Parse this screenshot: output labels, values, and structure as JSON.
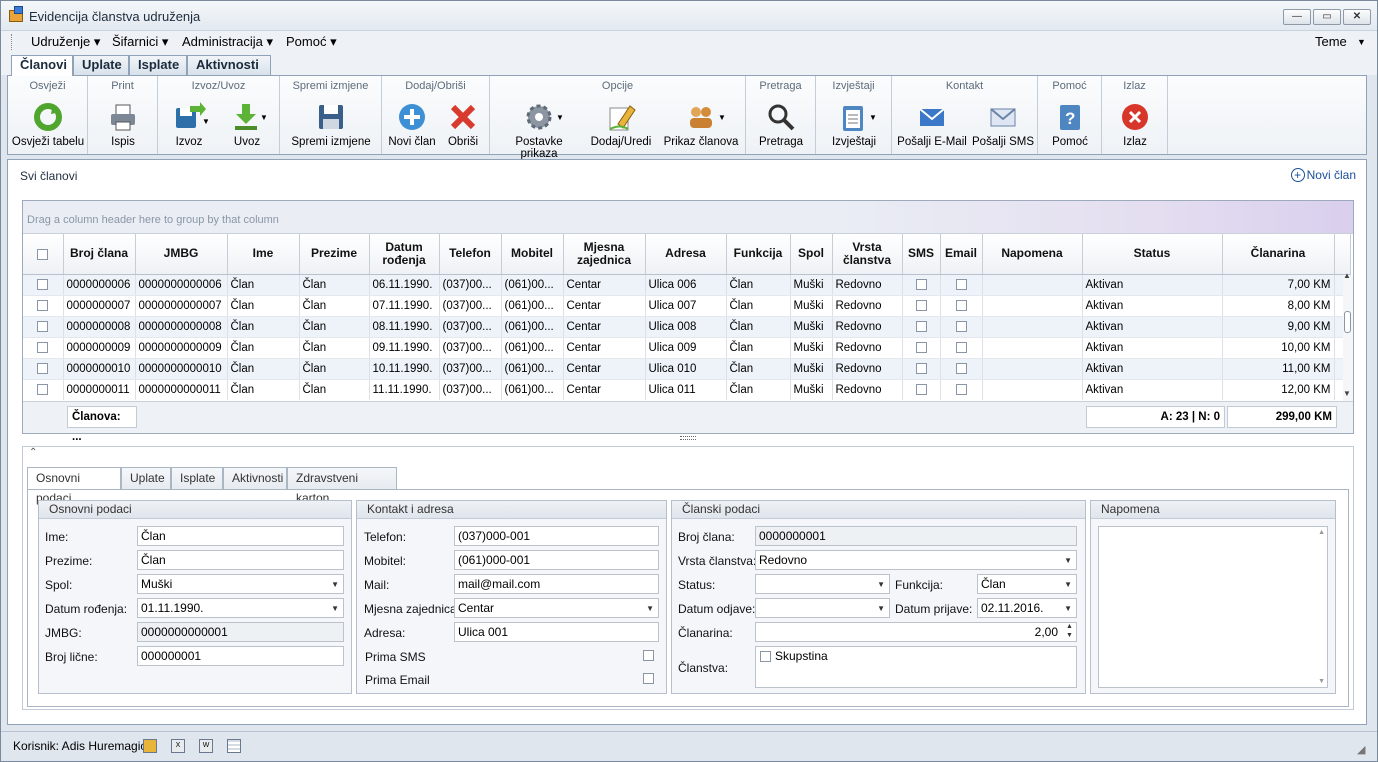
{
  "window": {
    "title": "Evidencija članstva udruženja"
  },
  "menu": [
    "Udruženje",
    "Šifarnici",
    "Administracija",
    "Pomoć"
  ],
  "theme_label": "Teme",
  "main_tabs": [
    "Članovi",
    "Uplate",
    "Isplate",
    "Aktivnosti"
  ],
  "ribbon": {
    "groups": [
      "Osvježi",
      "Print",
      "Izvoz/Uvoz",
      "Spremi izmjene",
      "Dodaj/Obriši",
      "Opcije",
      "Pretraga",
      "Izvještaji",
      "Kontakt",
      "Pomoć",
      "Izlaz"
    ],
    "buttons": [
      "Osvježi tabelu",
      "Ispis",
      "Izvoz",
      "Uvoz",
      "Spremi izmjene",
      "Novi član",
      "Obriši",
      "Postavke prikaza",
      "Dodaj/Uredi",
      "Prikaz članova",
      "Pretraga",
      "Izvještaji",
      "Pošalji E-Mail",
      "Pošalji SMS",
      "Pomoć",
      "Izlaz"
    ]
  },
  "content": {
    "title": "Svi članovi",
    "new_link": "Novi član"
  },
  "grid": {
    "group_hint": "Drag a column header here to group by that column",
    "columns": [
      "Broj člana",
      "JMBG",
      "Ime",
      "Prezime",
      "Datum rođenja",
      "Telefon",
      "Mobitel",
      "Mjesna zajednica",
      "Adresa",
      "Funkcija",
      "Spol",
      "Vrsta članstva",
      "SMS",
      "Email",
      "Napomena",
      "Status",
      "Članarina"
    ],
    "rows": [
      [
        "0000000006",
        "0000000000006",
        "Član",
        "Član",
        "06.11.1990.",
        "(037)00...",
        "(061)00...",
        "Centar",
        "Ulica 006",
        "Član",
        "Muški",
        "Redovno",
        "",
        "",
        "",
        "Aktivan",
        "7,00 KM"
      ],
      [
        "0000000007",
        "0000000000007",
        "Član",
        "Član",
        "07.11.1990.",
        "(037)00...",
        "(061)00...",
        "Centar",
        "Ulica 007",
        "Član",
        "Muški",
        "Redovno",
        "",
        "",
        "",
        "Aktivan",
        "8,00 KM"
      ],
      [
        "0000000008",
        "0000000000008",
        "Član",
        "Član",
        "08.11.1990.",
        "(037)00...",
        "(061)00...",
        "Centar",
        "Ulica 008",
        "Član",
        "Muški",
        "Redovno",
        "",
        "",
        "",
        "Aktivan",
        "9,00 KM"
      ],
      [
        "0000000009",
        "0000000000009",
        "Član",
        "Član",
        "09.11.1990.",
        "(037)00...",
        "(061)00...",
        "Centar",
        "Ulica 009",
        "Član",
        "Muški",
        "Redovno",
        "",
        "",
        "",
        "Aktivan",
        "10,00 KM"
      ],
      [
        "0000000010",
        "0000000000010",
        "Član",
        "Član",
        "10.11.1990.",
        "(037)00...",
        "(061)00...",
        "Centar",
        "Ulica 010",
        "Član",
        "Muški",
        "Redovno",
        "",
        "",
        "",
        "Aktivan",
        "11,00 KM"
      ],
      [
        "0000000011",
        "0000000000011",
        "Član",
        "Član",
        "11.11.1990.",
        "(037)00...",
        "(061)00...",
        "Centar",
        "Ulica 011",
        "Član",
        "Muški",
        "Redovno",
        "",
        "",
        "",
        "Aktivan",
        "12,00 KM"
      ]
    ],
    "footer": {
      "count": "Članova: ...",
      "status_summary": "A: 23 | N: 0",
      "total": "299,00 KM"
    }
  },
  "detail_tabs": [
    "Osnovni podaci",
    "Uplate",
    "Isplate",
    "Aktivnosti",
    "Zdravstveni karton"
  ],
  "osnovni": {
    "title": "Osnovni podaci",
    "labels": [
      "Ime:",
      "Prezime:",
      "Spol:",
      "Datum rođenja:",
      "JMBG:",
      "Broj lične:"
    ],
    "values": [
      "Član",
      "Član",
      "Muški",
      "01.11.1990.",
      "0000000000001",
      "000000001"
    ]
  },
  "kontakt": {
    "title": "Kontakt i adresa",
    "labels": [
      "Telefon:",
      "Mobitel:",
      "Mail:",
      "Mjesna zajednica:",
      "Adresa:",
      "Prima SMS",
      "Prima Email"
    ],
    "values": [
      "(037)000-001",
      "(061)000-001",
      "mail@mail.com",
      "Centar",
      "Ulica 001"
    ]
  },
  "clanski": {
    "title": "Članski podaci",
    "labels": [
      "Broj člana:",
      "Vrsta članstva:",
      "Status:",
      "Funkcija:",
      "Datum odjave:",
      "Datum prijave:",
      "Članarina:",
      "Članstva:"
    ],
    "broj": "0000000001",
    "vrsta": "Redovno",
    "status": "",
    "funkcija": "Član",
    "datum_odjave": "",
    "datum_prijave": "02.11.2016.",
    "clanarina": "2,00",
    "clanstvo_item": "Skupstina"
  },
  "napomena": {
    "title": "Napomena"
  },
  "statusbar": {
    "user": "Korisnik: Adis Huremagic"
  }
}
